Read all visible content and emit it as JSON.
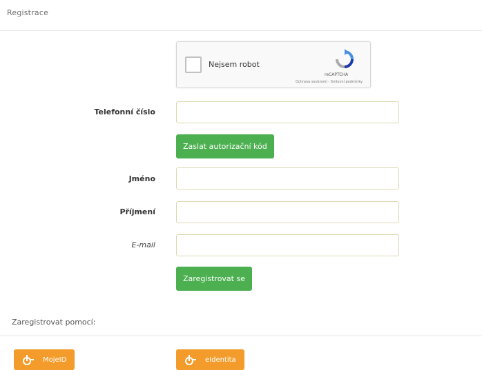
{
  "section": {
    "title": "Registrace"
  },
  "captcha": {
    "label": "Nejsem robot",
    "brand": "reCAPTCHA",
    "terms": "Ochrana soukromí - Smluvní podmínky",
    "icon": "recaptcha-icon"
  },
  "form": {
    "phone_label": "Telefonní číslo",
    "phone_value": "",
    "send_code_button": "Zaslat autorizační kód",
    "first_name_label": "Jméno",
    "first_name_value": "",
    "last_name_label": "Příjmení",
    "last_name_value": "",
    "email_label": "E-mail",
    "email_value": "",
    "register_button": "Zaregistrovat se"
  },
  "register_with": {
    "label": "Zaregistrovat pomocí:",
    "buttons": [
      {
        "label": "MojeID",
        "icon": "id-provider-icon"
      },
      {
        "label": "eIdentita",
        "icon": "id-provider-icon"
      }
    ]
  },
  "colors": {
    "primary_button": "#4caf50",
    "provider_button": "#f39c2b"
  }
}
